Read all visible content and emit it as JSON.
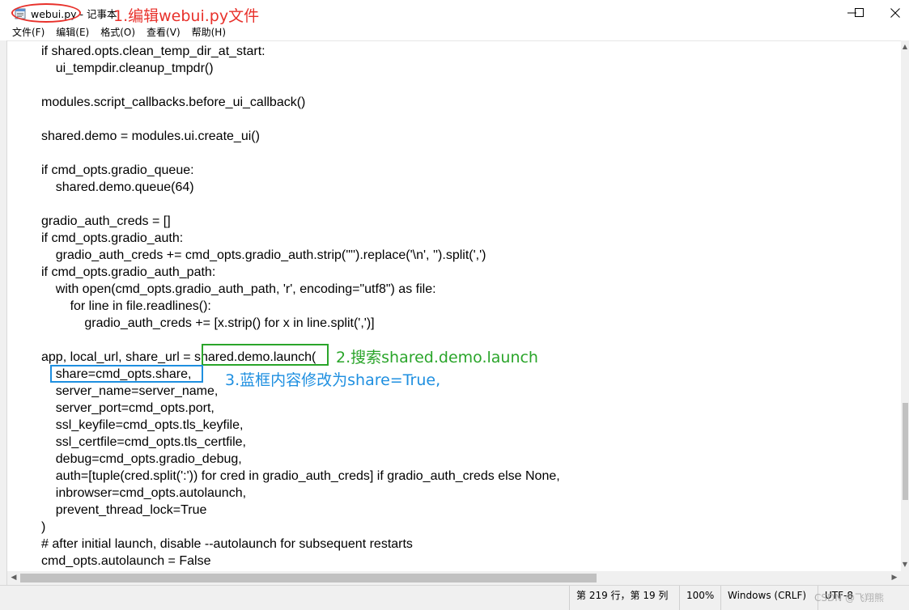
{
  "window": {
    "file_name": "webui.py",
    "title_suffix": "- 记事本",
    "minimize_label": "—",
    "maximize_label": "☐",
    "close_label": "✕"
  },
  "menu": {
    "items": [
      {
        "label": "文件(F)"
      },
      {
        "label": "编辑(E)"
      },
      {
        "label": "格式(O)"
      },
      {
        "label": "查看(V)"
      },
      {
        "label": "帮助(H)"
      }
    ]
  },
  "editor": {
    "lines": [
      "if shared.opts.clean_temp_dir_at_start:",
      "    ui_tempdir.cleanup_tmpdr()",
      "",
      "modules.script_callbacks.before_ui_callback()",
      "",
      "shared.demo = modules.ui.create_ui()",
      "",
      "if cmd_opts.gradio_queue:",
      "    shared.demo.queue(64)",
      "",
      "gradio_auth_creds = []",
      "if cmd_opts.gradio_auth:",
      "    gradio_auth_creds += cmd_opts.gradio_auth.strip('\"').replace('\\n', '').split(',')",
      "if cmd_opts.gradio_auth_path:",
      "    with open(cmd_opts.gradio_auth_path, 'r', encoding=\"utf8\") as file:",
      "        for line in file.readlines():",
      "            gradio_auth_creds += [x.strip() for x in line.split(',')]",
      "",
      "app, local_url, share_url = shared.demo.launch(",
      "    share=cmd_opts.share,",
      "    server_name=server_name,",
      "    server_port=cmd_opts.port,",
      "    ssl_keyfile=cmd_opts.tls_keyfile,",
      "    ssl_certfile=cmd_opts.tls_certfile,",
      "    debug=cmd_opts.gradio_debug,",
      "    auth=[tuple(cred.split(':')) for cred in gradio_auth_creds] if gradio_auth_creds else None,",
      "    inbrowser=cmd_opts.autolaunch,",
      "    prevent_thread_lock=True",
      ")",
      "# after initial launch, disable --autolaunch for subsequent restarts",
      "cmd_opts.autolaunch = False"
    ]
  },
  "annotations": {
    "step1": "1.编辑webui.py文件",
    "step2": "2.搜索shared.demo.launch",
    "step3": "3.蓝框内容修改为share=True,"
  },
  "status": {
    "position": "第 219 行，第 19 列",
    "zoom": "100%",
    "line_ending": "Windows (CRLF)",
    "encoding": "UTF-8"
  },
  "watermark": "CSDN @飞翔熊"
}
